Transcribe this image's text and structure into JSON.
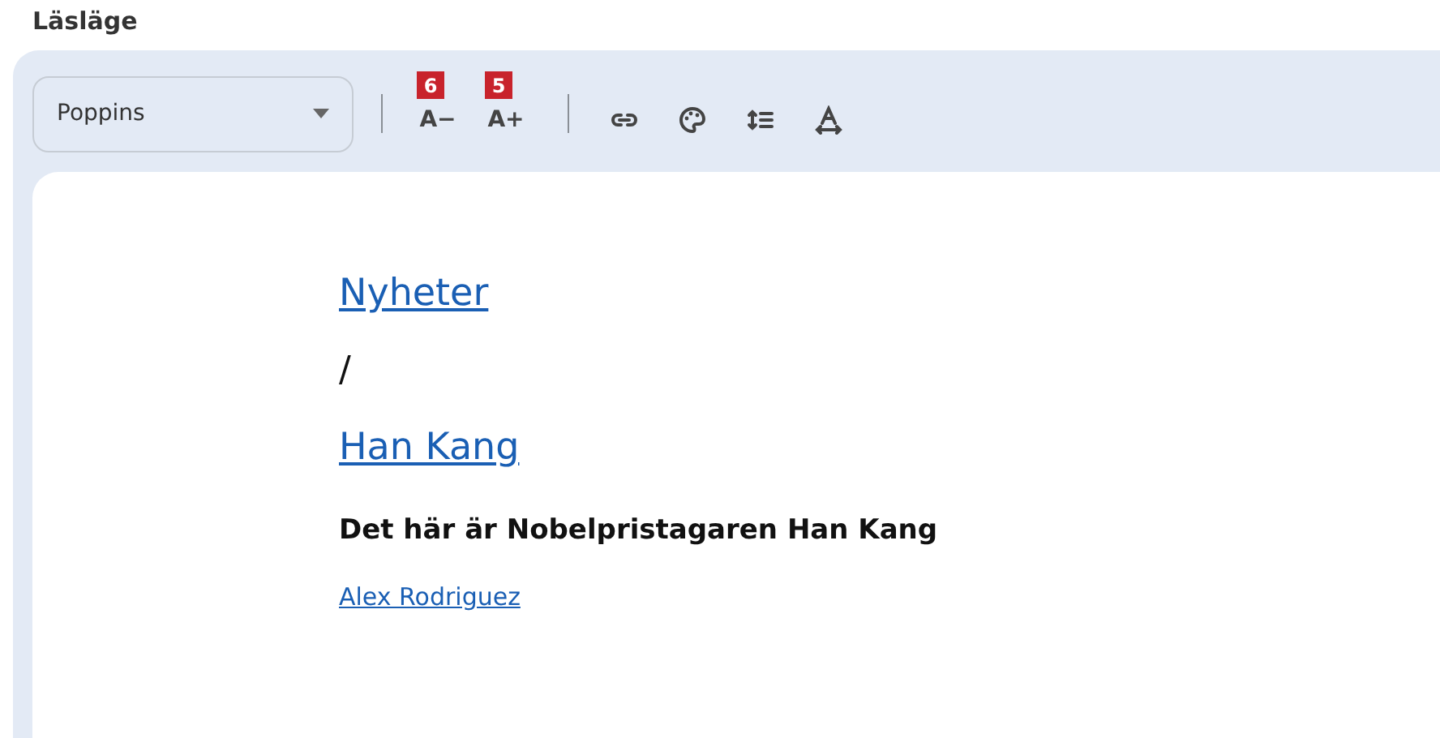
{
  "title": "Läsläge",
  "toolbar": {
    "font_select": {
      "value": "Poppins"
    },
    "tools": [
      {
        "kind": "text",
        "label": "A−",
        "badge": "6"
      },
      {
        "kind": "text",
        "label": "A+",
        "badge": "5"
      },
      {
        "kind": "divider"
      },
      {
        "kind": "link"
      },
      {
        "kind": "palette"
      },
      {
        "kind": "spacing"
      },
      {
        "kind": "width"
      }
    ]
  },
  "content": [
    {
      "kind": "heading-link",
      "text": "Nyheter"
    },
    {
      "kind": "separator",
      "text": "/"
    },
    {
      "kind": "heading-link",
      "text": "Han Kang"
    },
    {
      "kind": "subtitle",
      "text": "Det här är Nobelpristagaren Han Kang"
    },
    {
      "kind": "author-link",
      "text": "Alex Rodriguez"
    }
  ]
}
